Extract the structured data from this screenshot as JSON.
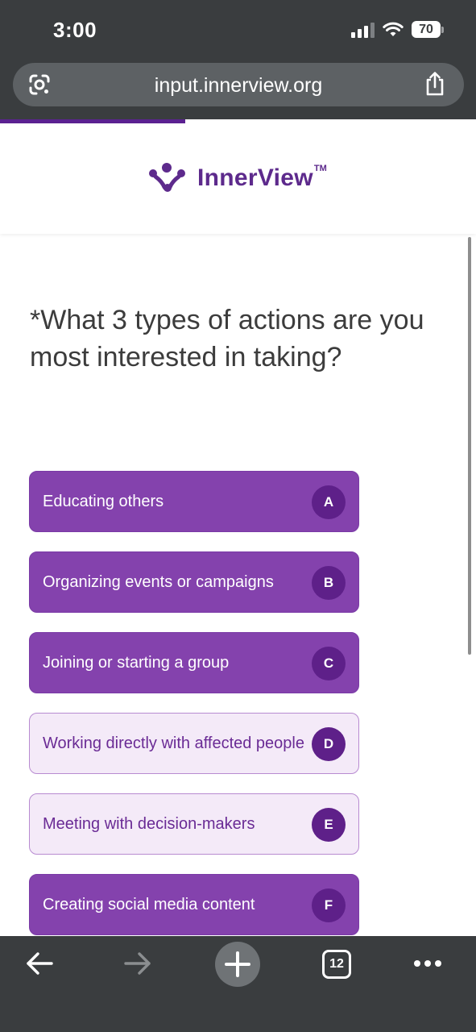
{
  "status": {
    "time": "3:00",
    "battery": "70"
  },
  "browser": {
    "url": "input.innerview.org",
    "tab_count": "12",
    "icons": {
      "lens": "google-lens-icon",
      "share": "share-icon",
      "back": "back-arrow-icon",
      "forward": "forward-arrow-icon",
      "new_tab": "plus-icon",
      "more": "more-dots-icon"
    },
    "progress_fraction": 0.39
  },
  "brand": {
    "name": "InnerView",
    "trademark": "TM",
    "color": "#5d2a8c"
  },
  "question": {
    "text": "*What 3 types of actions are you most interested in taking?"
  },
  "options": [
    {
      "label": "Educating others",
      "key": "A",
      "selected": true
    },
    {
      "label": "Organizing events or campaigns",
      "key": "B",
      "selected": true
    },
    {
      "label": "Joining or starting a group",
      "key": "C",
      "selected": true
    },
    {
      "label": "Working directly with affected people",
      "key": "D",
      "selected": false
    },
    {
      "label": "Meeting with decision-makers",
      "key": "E",
      "selected": false
    },
    {
      "label": "Creating social media content",
      "key": "F",
      "selected": true
    }
  ],
  "colors": {
    "selected_fill": "#8442ad",
    "unselected_fill": "#f4eaf8",
    "key_badge": "#5e2089",
    "chrome": "#3a3d3f"
  }
}
